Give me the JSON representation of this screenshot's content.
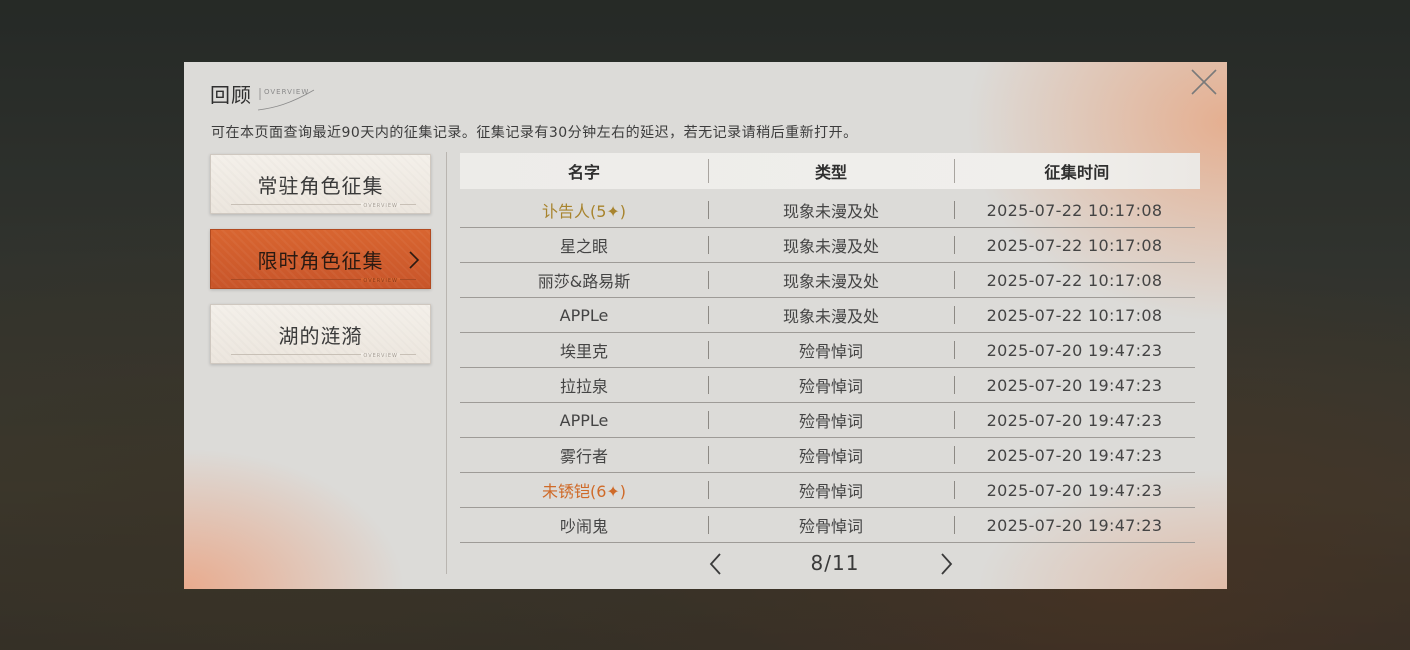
{
  "panel": {
    "title": "回顾",
    "subtitle": "OVERVIEW",
    "description": "可在本页面查询最近90天内的征集记录。征集记录有30分钟左右的延迟，若无记录请稍后重新打开。"
  },
  "tabs": [
    {
      "label": "常驻角色征集",
      "tag": "OVERVIEW",
      "active": false
    },
    {
      "label": "限时角色征集",
      "tag": "OVERVIEW",
      "active": true
    },
    {
      "label": "湖的涟漪",
      "tag": "OVERVIEW",
      "active": false
    }
  ],
  "table": {
    "headers": [
      "名字",
      "类型",
      "征集时间"
    ],
    "rows": [
      {
        "name": "讣告人(5✦)",
        "type": "现象未漫及处",
        "time": "2025-07-22 10:17:08",
        "rarity": "gold"
      },
      {
        "name": "星之眼",
        "type": "现象未漫及处",
        "time": "2025-07-22 10:17:08",
        "rarity": "normal"
      },
      {
        "name": "丽莎&路易斯",
        "type": "现象未漫及处",
        "time": "2025-07-22 10:17:08",
        "rarity": "normal"
      },
      {
        "name": "APPLe",
        "type": "现象未漫及处",
        "time": "2025-07-22 10:17:08",
        "rarity": "normal"
      },
      {
        "name": "埃里克",
        "type": "殓骨悼词",
        "time": "2025-07-20 19:47:23",
        "rarity": "normal"
      },
      {
        "name": "拉拉泉",
        "type": "殓骨悼词",
        "time": "2025-07-20 19:47:23",
        "rarity": "normal"
      },
      {
        "name": "APPLe",
        "type": "殓骨悼词",
        "time": "2025-07-20 19:47:23",
        "rarity": "normal"
      },
      {
        "name": "雾行者",
        "type": "殓骨悼词",
        "time": "2025-07-20 19:47:23",
        "rarity": "normal"
      },
      {
        "name": "未锈铠(6✦)",
        "type": "殓骨悼词",
        "time": "2025-07-20 19:47:23",
        "rarity": "orange"
      },
      {
        "name": "吵闹鬼",
        "type": "殓骨悼词",
        "time": "2025-07-20 19:47:23",
        "rarity": "normal"
      }
    ]
  },
  "pagination": {
    "label": "8/11",
    "prev_icon": "chevron-left-icon",
    "next_icon": "chevron-right-icon"
  },
  "icons": {
    "close": "close-icon",
    "active_tab_indicator": "chevron-right-icon"
  },
  "colors": {
    "panel_bg": "#dcdbd8",
    "active_tab": "#d05d2c",
    "gold_text": "#a8842e",
    "orange_text": "#cf6a28"
  }
}
